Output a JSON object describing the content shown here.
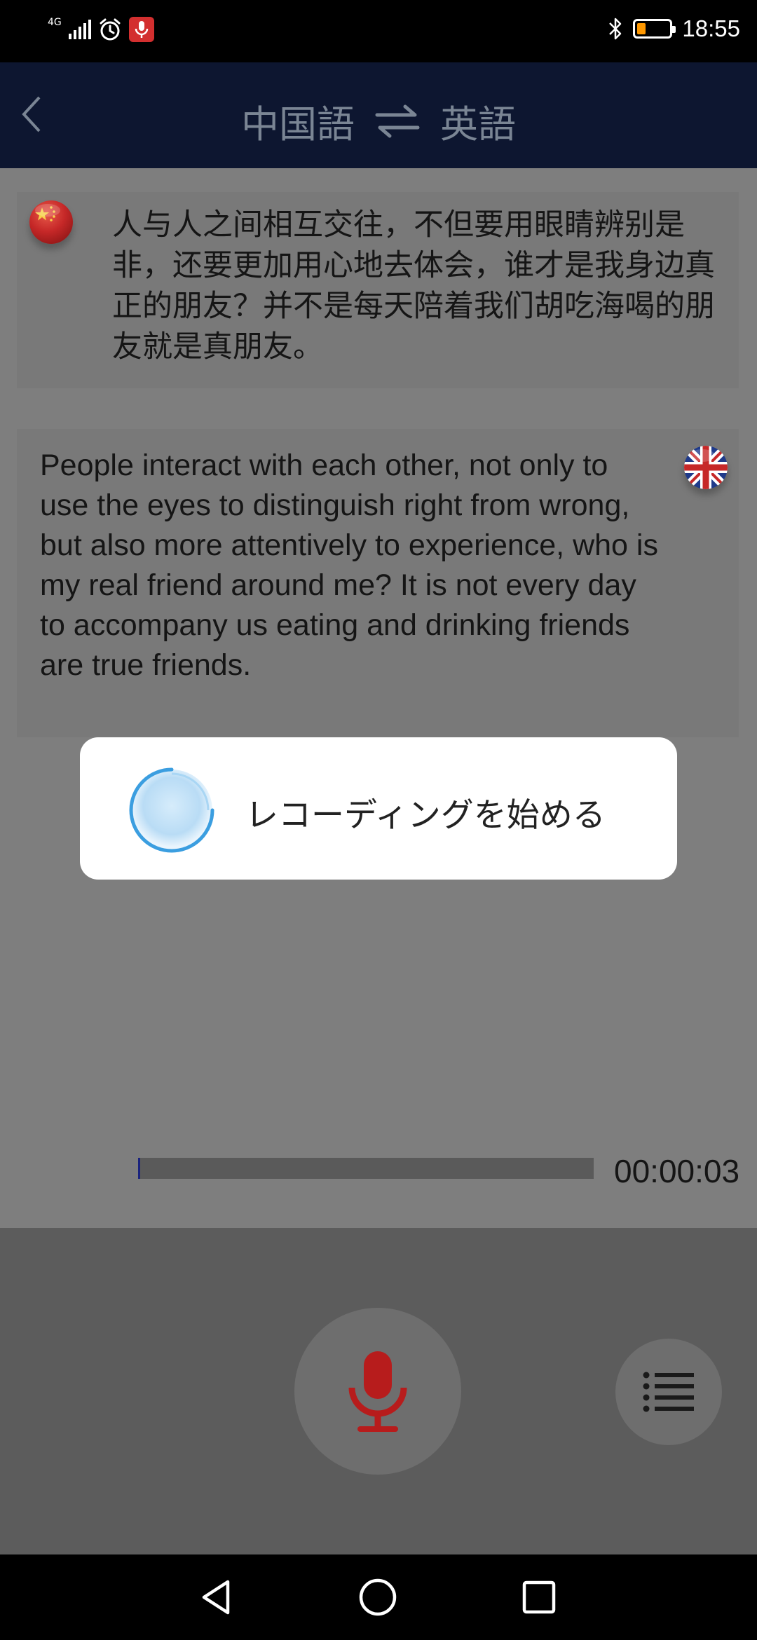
{
  "status_bar": {
    "network": "4G",
    "time": "18:55",
    "icons": [
      "signal-icon",
      "alarm-icon",
      "mic-recording-icon",
      "bluetooth-icon",
      "battery-icon"
    ]
  },
  "header": {
    "source_lang": "中国語",
    "target_lang": "英語",
    "back_icon": "chevron-left-icon",
    "swap_icon": "swap-arrows-icon"
  },
  "conversation": [
    {
      "lang": "chinese",
      "flag": "china-flag-icon",
      "text": "人与人之间相互交往，不但要用眼睛辨别是非，还要更加用心地去体会，谁才是我身边真正的朋友？并不是每天陪着我们胡吃海喝的朋友就是真朋友。"
    },
    {
      "lang": "english",
      "flag": "uk-flag-icon",
      "text": "People interact with each other, not only to use the eyes to distinguish right from wrong, but also more attentively to experience, who is my real friend around me? It is not every day to accompany us eating and drinking friends are true friends."
    }
  ],
  "recording": {
    "elapsed": "00:00:03",
    "progress": 0.005
  },
  "dialog": {
    "message": "レコーディングを始める"
  },
  "controls": {
    "mic_icon": "microphone-icon",
    "list_icon": "list-icon"
  },
  "colors": {
    "header_bg": "#0d1630",
    "mic_red": "#b71c1c",
    "overlay": "#808080"
  }
}
